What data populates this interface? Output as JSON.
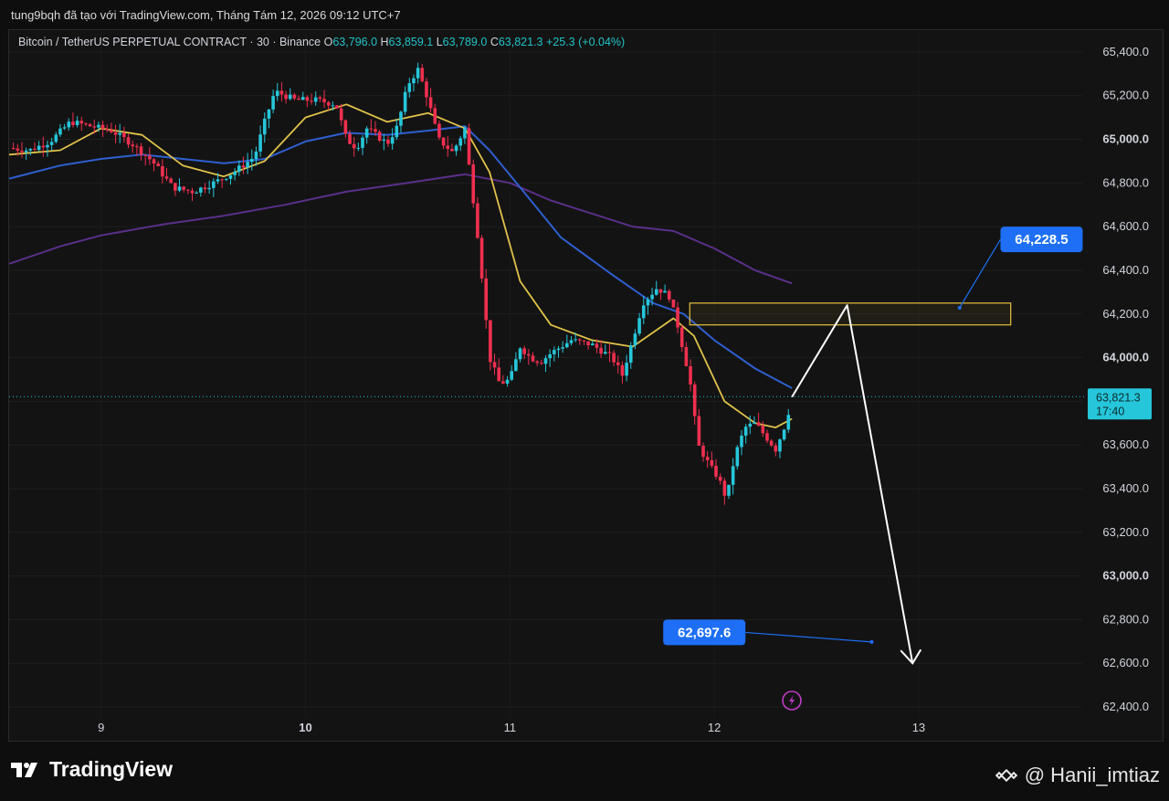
{
  "header": {
    "caption": "tung9bqh đã tạo với TradingView.com, Tháng Tám 12, 2026 09:12 UTC+7"
  },
  "legend": {
    "symbol": "Bitcoin / TetherUS PERPETUAL CONTRACT · 30 · Binance",
    "o_label": "O",
    "o_value": "63,796.0",
    "h_label": "H",
    "h_value": "63,859.1",
    "l_label": "L",
    "l_value": "63,789.0",
    "c_label": "C",
    "c_value": "63,821.3",
    "change": "+25.3 (+0.04%)"
  },
  "brand": {
    "name": "TradingView"
  },
  "credit": {
    "text": "@ Hanii_imtiaz"
  },
  "colors": {
    "up": "#26c6da",
    "down": "#ef2f4f",
    "ema_fast": "#e0c24a",
    "ema_mid": "#2f5fd0",
    "ema_slow": "#5b2f8a",
    "label_blue": "#1e6ff5",
    "zone": "#d8b63a"
  },
  "chart_data": {
    "type": "candlestick",
    "timeframe": "30",
    "y_ticks": [
      "65,400.0",
      "65,200.0",
      "65,000.0",
      "64,800.0",
      "64,600.0",
      "64,400.0",
      "64,200.0",
      "64,000.0",
      "63,800.0",
      "63,600.0",
      "63,400.0",
      "63,200.0",
      "63,000.0",
      "62,800.0",
      "62,600.0",
      "62,400.0"
    ],
    "y_range": [
      62350,
      65500
    ],
    "x_ticks": [
      {
        "label": "9",
        "bold": false,
        "x": 9.0
      },
      {
        "label": "10",
        "bold": true,
        "x": 10.0
      },
      {
        "label": "11",
        "bold": false,
        "x": 11.0
      },
      {
        "label": "12",
        "bold": false,
        "x": 12.0
      },
      {
        "label": "13",
        "bold": false,
        "x": 13.0
      }
    ],
    "x_range": [
      8.55,
      13.8
    ],
    "last_price": {
      "value": 63821.3,
      "label": "63,821.3",
      "countdown": "17:40"
    },
    "price_path": [
      [
        8.55,
        64960
      ],
      [
        8.65,
        64950
      ],
      [
        8.75,
        64990
      ],
      [
        8.85,
        65080
      ],
      [
        8.95,
        65060
      ],
      [
        9.05,
        65040
      ],
      [
        9.15,
        64980
      ],
      [
        9.25,
        64900
      ],
      [
        9.35,
        64780
      ],
      [
        9.45,
        64760
      ],
      [
        9.55,
        64800
      ],
      [
        9.65,
        64850
      ],
      [
        9.75,
        64920
      ],
      [
        9.8,
        65080
      ],
      [
        9.85,
        65220
      ],
      [
        9.95,
        65180
      ],
      [
        10.05,
        65180
      ],
      [
        10.15,
        65160
      ],
      [
        10.2,
        65000
      ],
      [
        10.25,
        64960
      ],
      [
        10.3,
        65050
      ],
      [
        10.4,
        64980
      ],
      [
        10.45,
        65060
      ],
      [
        10.5,
        65250
      ],
      [
        10.55,
        65320
      ],
      [
        10.6,
        65180
      ],
      [
        10.65,
        65000
      ],
      [
        10.72,
        64940
      ],
      [
        10.78,
        65050
      ],
      [
        10.8,
        64880
      ],
      [
        10.85,
        64500
      ],
      [
        10.9,
        64000
      ],
      [
        10.95,
        63880
      ],
      [
        11.0,
        63900
      ],
      [
        11.05,
        64050
      ],
      [
        11.1,
        64000
      ],
      [
        11.15,
        63980
      ],
      [
        11.2,
        64020
      ],
      [
        11.3,
        64080
      ],
      [
        11.4,
        64060
      ],
      [
        11.5,
        64000
      ],
      [
        11.55,
        63920
      ],
      [
        11.6,
        64080
      ],
      [
        11.65,
        64250
      ],
      [
        11.72,
        64320
      ],
      [
        11.78,
        64280
      ],
      [
        11.82,
        64150
      ],
      [
        11.88,
        63900
      ],
      [
        11.92,
        63600
      ],
      [
        11.98,
        63500
      ],
      [
        12.02,
        63450
      ],
      [
        12.06,
        63350
      ],
      [
        12.1,
        63550
      ],
      [
        12.15,
        63680
      ],
      [
        12.2,
        63700
      ],
      [
        12.25,
        63640
      ],
      [
        12.3,
        63580
      ],
      [
        12.35,
        63700
      ],
      [
        12.38,
        63820
      ]
    ],
    "ema_fast": [
      [
        8.55,
        64930
      ],
      [
        8.8,
        64950
      ],
      [
        9.0,
        65050
      ],
      [
        9.2,
        65020
      ],
      [
        9.4,
        64880
      ],
      [
        9.6,
        64830
      ],
      [
        9.8,
        64900
      ],
      [
        10.0,
        65100
      ],
      [
        10.2,
        65160
      ],
      [
        10.4,
        65080
      ],
      [
        10.6,
        65120
      ],
      [
        10.78,
        65050
      ],
      [
        10.9,
        64850
      ],
      [
        11.05,
        64350
      ],
      [
        11.2,
        64150
      ],
      [
        11.4,
        64080
      ],
      [
        11.6,
        64050
      ],
      [
        11.8,
        64180
      ],
      [
        11.9,
        64100
      ],
      [
        12.05,
        63800
      ],
      [
        12.2,
        63700
      ],
      [
        12.3,
        63680
      ],
      [
        12.38,
        63720
      ]
    ],
    "ema_mid": [
      [
        8.55,
        64820
      ],
      [
        8.8,
        64880
      ],
      [
        9.0,
        64910
      ],
      [
        9.2,
        64930
      ],
      [
        9.4,
        64910
      ],
      [
        9.6,
        64890
      ],
      [
        9.8,
        64910
      ],
      [
        10.0,
        64990
      ],
      [
        10.2,
        65030
      ],
      [
        10.4,
        65020
      ],
      [
        10.6,
        65040
      ],
      [
        10.78,
        65060
      ],
      [
        10.9,
        64950
      ],
      [
        11.05,
        64780
      ],
      [
        11.25,
        64550
      ],
      [
        11.5,
        64380
      ],
      [
        11.7,
        64250
      ],
      [
        11.85,
        64200
      ],
      [
        12.0,
        64080
      ],
      [
        12.2,
        63950
      ],
      [
        12.38,
        63860
      ]
    ],
    "ema_slow": [
      [
        8.55,
        64430
      ],
      [
        8.8,
        64510
      ],
      [
        9.0,
        64560
      ],
      [
        9.3,
        64610
      ],
      [
        9.6,
        64650
      ],
      [
        9.9,
        64700
      ],
      [
        10.2,
        64760
      ],
      [
        10.5,
        64800
      ],
      [
        10.78,
        64840
      ],
      [
        11.0,
        64800
      ],
      [
        11.2,
        64720
      ],
      [
        11.4,
        64660
      ],
      [
        11.6,
        64600
      ],
      [
        11.8,
        64580
      ],
      [
        12.0,
        64500
      ],
      [
        12.2,
        64400
      ],
      [
        12.38,
        64340
      ]
    ],
    "zone": {
      "top": 64250,
      "bottom": 64150,
      "x_start": 11.88,
      "x_end": 13.45
    },
    "projection": [
      [
        12.38,
        63820
      ],
      [
        12.65,
        64240
      ],
      [
        12.97,
        62600
      ]
    ],
    "annotations": [
      {
        "label": "64,228.5",
        "price": 64228.5,
        "anchor_x": 13.2,
        "box_x": 13.4,
        "box_price": 64600
      },
      {
        "label": "62,697.6",
        "price": 62697.6,
        "anchor_x": 12.77,
        "box_x": 11.75,
        "box_price": 62800
      }
    ]
  }
}
